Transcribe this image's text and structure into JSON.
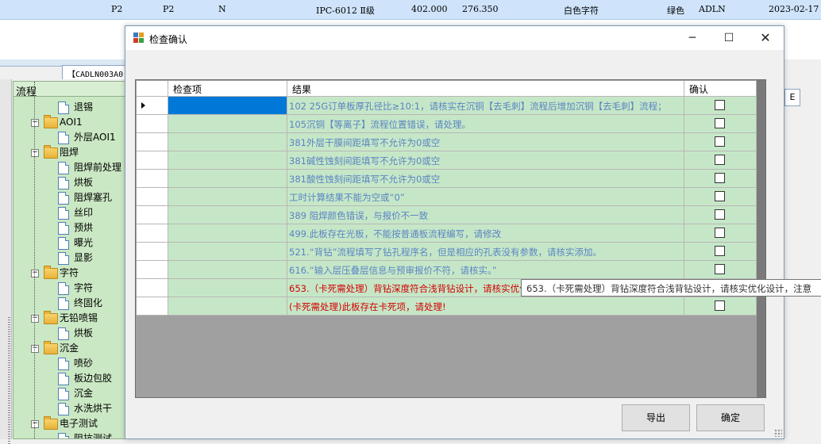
{
  "background_row": {
    "cells": [
      "P2",
      "P2",
      "N",
      "IPC-6012 Ⅱ级",
      "402.000",
      "276.350",
      "白色字符",
      "绿色",
      "ADLN",
      "2023-02-17"
    ]
  },
  "background_tab": {
    "label": "【CADLN003A0"
  },
  "tree": {
    "header": "流程",
    "items": [
      {
        "label": "退锡",
        "type": "leaf"
      },
      {
        "label": "AOI1",
        "type": "group"
      },
      {
        "label": "外层AOI1",
        "type": "leaf"
      },
      {
        "label": "阻焊",
        "type": "group"
      },
      {
        "label": "阻焊前处理",
        "type": "leaf"
      },
      {
        "label": "烘板",
        "type": "leaf"
      },
      {
        "label": "阻焊塞孔",
        "type": "leaf"
      },
      {
        "label": "丝印",
        "type": "leaf"
      },
      {
        "label": "预烘",
        "type": "leaf"
      },
      {
        "label": "曝光",
        "type": "leaf"
      },
      {
        "label": "显影",
        "type": "leaf"
      },
      {
        "label": "字符",
        "type": "group"
      },
      {
        "label": "字符",
        "type": "leaf"
      },
      {
        "label": "终固化",
        "type": "leaf"
      },
      {
        "label": "无铅喷锡",
        "type": "group"
      },
      {
        "label": "烘板",
        "type": "leaf"
      },
      {
        "label": "沉金",
        "type": "group"
      },
      {
        "label": "喷砂",
        "type": "leaf"
      },
      {
        "label": "板边包胶",
        "type": "leaf"
      },
      {
        "label": "沉金",
        "type": "leaf"
      },
      {
        "label": "水洗烘干",
        "type": "leaf"
      },
      {
        "label": "电子测试",
        "type": "group"
      },
      {
        "label": "阻抗测试",
        "type": "leaf"
      }
    ]
  },
  "right_tab_label": "E",
  "dialog": {
    "title": "检查确认",
    "window_buttons": {
      "minimize": "─",
      "maximize": "☐",
      "close": "✕"
    },
    "grid": {
      "headers": {
        "item": "检查项",
        "result": "结果",
        "confirm": "确认"
      },
      "rows": [
        {
          "result": "102 25G订单板厚孔径比≥10:1，请核实在沉铜【去毛刺】流程后增加沉铜【去毛刺】流程；",
          "red": false,
          "checked": false
        },
        {
          "result": "105沉铜【等离子】流程位置错误，请处理。",
          "red": false,
          "checked": false
        },
        {
          "result": "381外层干膜间距填写不允许为0或空",
          "red": false,
          "checked": false
        },
        {
          "result": "381碱性蚀刻间距填写不允许为0或空",
          "red": false,
          "checked": false
        },
        {
          "result": "381酸性蚀刻间距填写不允许为0或空",
          "red": false,
          "checked": false
        },
        {
          "result": "工时计算结果不能为空或“0”",
          "red": false,
          "checked": false
        },
        {
          "result": "389 阻焊颜色错误，与报价不一致",
          "red": false,
          "checked": false
        },
        {
          "result": "499.此板存在光板，不能按普通板流程编写，请修改",
          "red": false,
          "checked": false
        },
        {
          "result": "521.“背钻”流程填写了钻孔程序名，但是相应的孔表没有参数，请核实添加。",
          "red": false,
          "checked": false
        },
        {
          "result": "616.“输入层压叠层信息与预审报价不符，请核实。”",
          "red": false,
          "checked": false
        },
        {
          "result": "653.（卡死需处理）背钻深度符合浅背钻设计，请核实优化设计，注意",
          "red": true,
          "checked": null
        },
        {
          "result": "(卡死需处理)此板存在卡死项，请处理!",
          "red": true,
          "checked": false
        }
      ]
    },
    "tooltip": "653.（卡死需处理）背钻深度符合浅背钻设计，请核实优化设计，注意",
    "buttons": {
      "export": "导出",
      "confirm": "确定"
    }
  }
}
